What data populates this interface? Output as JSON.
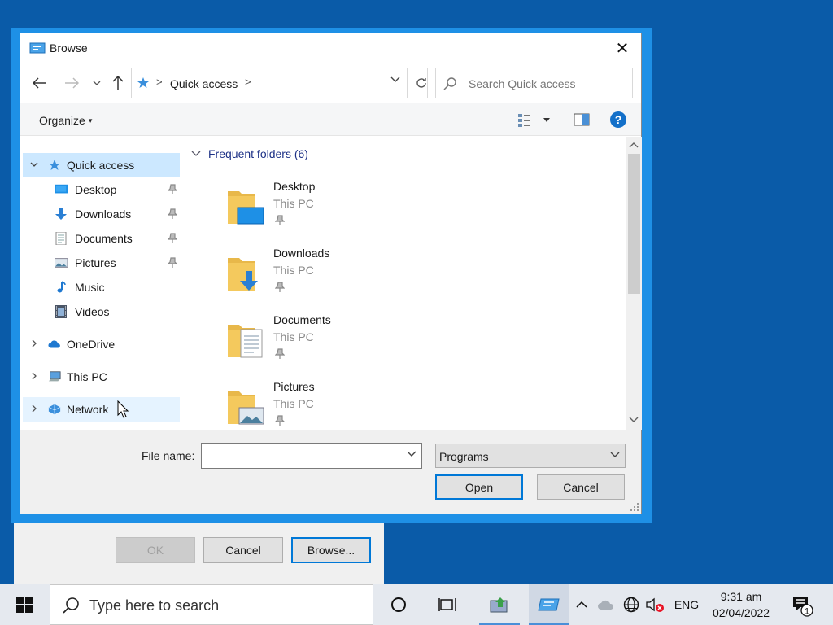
{
  "background_dialog": {
    "ok_label": "OK",
    "cancel_label": "Cancel",
    "browse_label": "Browse..."
  },
  "dialog": {
    "title": "Browse",
    "close_glyph": "✕",
    "address": {
      "location": "Quick access",
      "separator": ">"
    },
    "search_placeholder": "Search Quick access",
    "toolbar": {
      "organize_label": "Organize",
      "organize_caret": "▾"
    },
    "nav": {
      "items": [
        {
          "label": "Quick access",
          "icon": "quick-access-star-icon",
          "expanded": true,
          "selected": true
        },
        {
          "label": "Desktop",
          "icon": "desktop-icon",
          "pinned": true
        },
        {
          "label": "Downloads",
          "icon": "downloads-icon",
          "pinned": true
        },
        {
          "label": "Documents",
          "icon": "documents-icon",
          "pinned": true
        },
        {
          "label": "Pictures",
          "icon": "pictures-icon",
          "pinned": true
        },
        {
          "label": "Music",
          "icon": "music-icon"
        },
        {
          "label": "Videos",
          "icon": "videos-icon"
        },
        {
          "label": "OneDrive",
          "icon": "onedrive-icon"
        },
        {
          "label": "This PC",
          "icon": "this-pc-icon"
        },
        {
          "label": "Network",
          "icon": "network-icon",
          "hovered": true
        }
      ]
    },
    "content": {
      "group_header": "Frequent folders (6)",
      "folders": [
        {
          "name": "Desktop",
          "location": "This PC"
        },
        {
          "name": "Downloads",
          "location": "This PC"
        },
        {
          "name": "Documents",
          "location": "This PC"
        },
        {
          "name": "Pictures",
          "location": "This PC"
        }
      ]
    },
    "bottom": {
      "file_name_label": "File name:",
      "file_name_value": "",
      "file_type_value": "Programs",
      "open_label": "Open",
      "cancel_label": "Cancel"
    }
  },
  "taskbar": {
    "search_placeholder": "Type here to search",
    "language": "ENG",
    "time": "9:31 am",
    "date": "02/04/2022",
    "notification_count": "1"
  },
  "colors": {
    "desktop_bg": "#0a5ba8",
    "accent": "#0078d7",
    "selection": "#cce8ff",
    "folder_yellow": "#f4c95d"
  }
}
